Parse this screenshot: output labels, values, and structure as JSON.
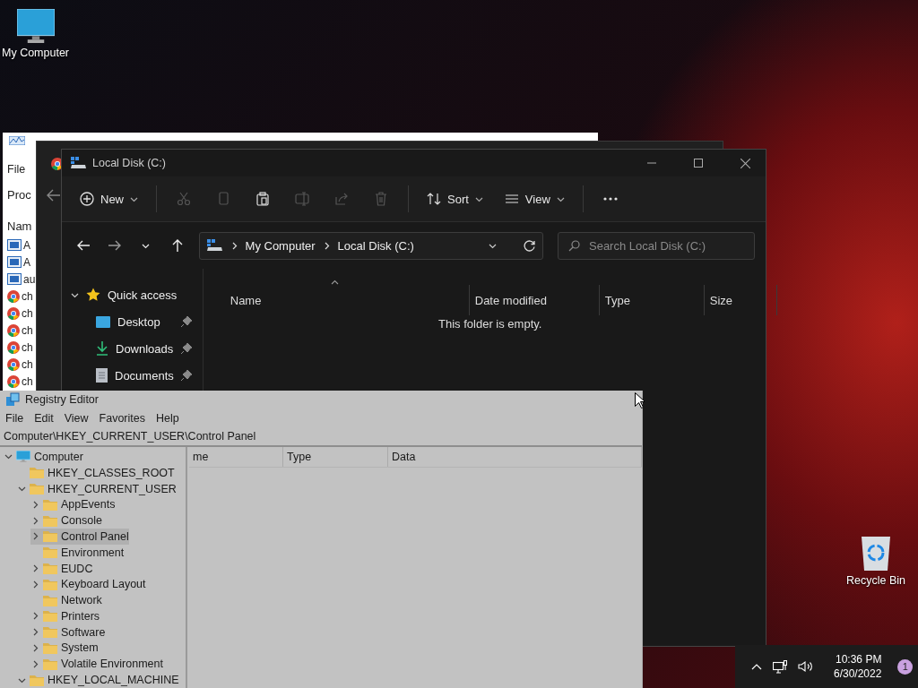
{
  "desktop_icons": [
    {
      "label": "My Computer",
      "kind": "computer"
    },
    {
      "label": "Recycle Bin",
      "kind": "recycle"
    }
  ],
  "task_manager": {
    "menu": "File",
    "tab": "Proc",
    "column": "Nam",
    "rows": [
      {
        "text": "A",
        "kind": "app"
      },
      {
        "text": "A",
        "kind": "app"
      },
      {
        "text": "au",
        "kind": "app"
      },
      {
        "text": "ch",
        "kind": "chrome"
      },
      {
        "text": "ch",
        "kind": "chrome"
      },
      {
        "text": "ch",
        "kind": "chrome"
      },
      {
        "text": "ch",
        "kind": "chrome"
      },
      {
        "text": "ch",
        "kind": "chrome"
      },
      {
        "text": "ch",
        "kind": "chrome"
      }
    ]
  },
  "explorer": {
    "title": "Local Disk (C:)",
    "toolbar": [
      {
        "label": "New",
        "kind": "new",
        "disabled": false
      },
      {
        "kind": "cut",
        "disabled": true
      },
      {
        "kind": "copy",
        "disabled": true
      },
      {
        "kind": "paste",
        "disabled": false
      },
      {
        "kind": "rename",
        "disabled": true
      },
      {
        "kind": "share",
        "disabled": true
      },
      {
        "kind": "delete",
        "disabled": true
      },
      {
        "label": "Sort",
        "kind": "sort",
        "disabled": false
      },
      {
        "label": "View",
        "kind": "view",
        "disabled": false
      },
      {
        "kind": "more",
        "disabled": false
      }
    ],
    "breadcrumb": [
      "My Computer",
      "Local Disk (C:)"
    ],
    "search": {
      "placeholder": "Search Local Disk (C:)"
    },
    "nav": [
      {
        "label": "Quick access",
        "kind": "star",
        "expanded": true,
        "children": [
          {
            "label": "Desktop",
            "kind": "desktop",
            "pinned": true
          },
          {
            "label": "Downloads",
            "kind": "download",
            "pinned": true
          },
          {
            "label": "Documents",
            "kind": "document",
            "pinned": true
          }
        ]
      }
    ],
    "columns": [
      "Name",
      "Date modified",
      "Type",
      "Size"
    ],
    "empty_message": "This folder is empty."
  },
  "registry": {
    "title": "Registry Editor",
    "menu": [
      "File",
      "Edit",
      "View",
      "Favorites",
      "Help"
    ],
    "address": "Computer\\HKEY_CURRENT_USER\\Control Panel",
    "tree": [
      {
        "label": "Computer",
        "kind": "computer",
        "expandable": true,
        "expanded": true,
        "selected": false,
        "children": [
          {
            "label": "HKEY_CLASSES_ROOT",
            "kind": "folder",
            "expandable": false,
            "expanded": false,
            "selected": false
          },
          {
            "label": "HKEY_CURRENT_USER",
            "kind": "folder",
            "expandable": true,
            "expanded": true,
            "selected": false,
            "children": [
              {
                "label": "AppEvents",
                "kind": "folder",
                "expandable": true,
                "expanded": false,
                "selected": false
              },
              {
                "label": "Console",
                "kind": "folder",
                "expandable": true,
                "expanded": false,
                "selected": false
              },
              {
                "label": "Control Panel",
                "kind": "folder",
                "expandable": true,
                "expanded": false,
                "selected": true
              },
              {
                "label": "Environment",
                "kind": "folder",
                "expandable": false,
                "expanded": false,
                "selected": false
              },
              {
                "label": "EUDC",
                "kind": "folder",
                "expandable": true,
                "expanded": false,
                "selected": false
              },
              {
                "label": "Keyboard Layout",
                "kind": "folder",
                "expandable": true,
                "expanded": false,
                "selected": false
              },
              {
                "label": "Network",
                "kind": "folder",
                "expandable": false,
                "expanded": false,
                "selected": false
              },
              {
                "label": "Printers",
                "kind": "folder",
                "expandable": true,
                "expanded": false,
                "selected": false
              },
              {
                "label": "Software",
                "kind": "folder",
                "expandable": true,
                "expanded": false,
                "selected": false
              },
              {
                "label": "System",
                "kind": "folder",
                "expandable": true,
                "expanded": false,
                "selected": false
              },
              {
                "label": "Volatile Environment",
                "kind": "folder",
                "expandable": true,
                "expanded": false,
                "selected": false
              }
            ]
          },
          {
            "label": "HKEY_LOCAL_MACHINE",
            "kind": "folder",
            "expandable": true,
            "expanded": true,
            "selected": false
          }
        ]
      }
    ],
    "columns": [
      "me",
      "Type",
      "Data"
    ]
  },
  "tray": {
    "time": "10:36 PM",
    "date": "6/30/2022",
    "notification_count": "1"
  }
}
